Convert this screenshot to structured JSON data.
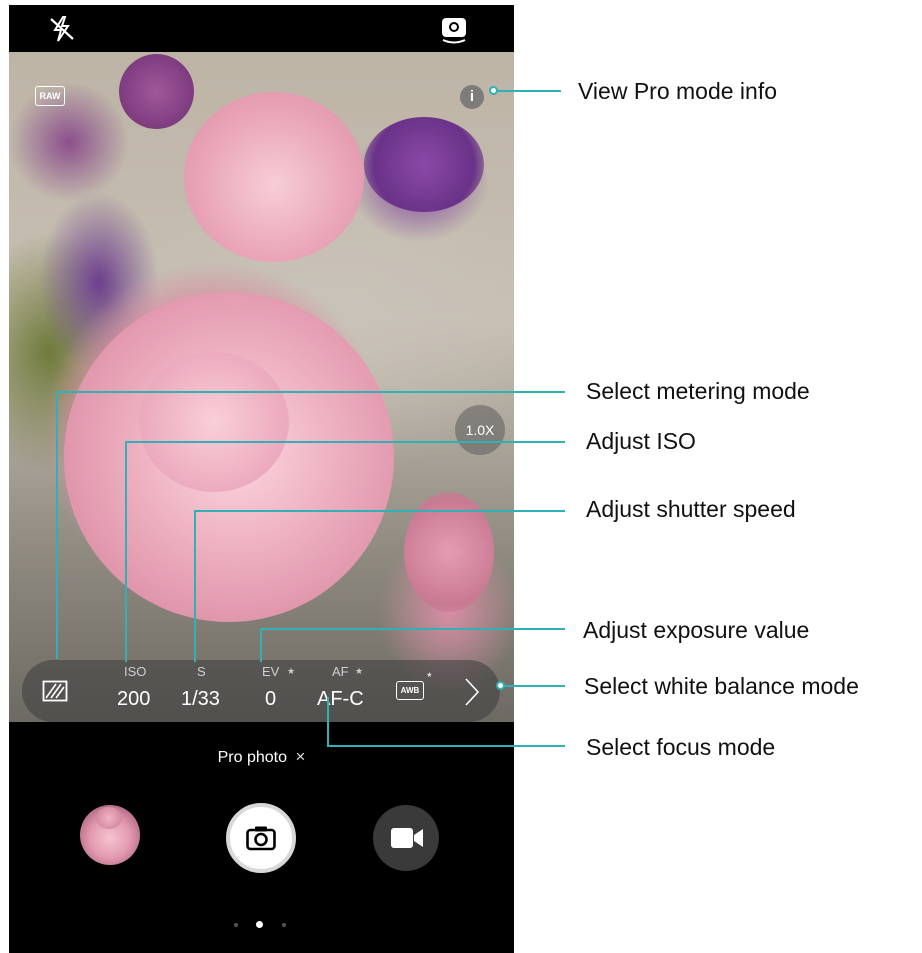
{
  "zoom_label": "1.0X",
  "raw_badge": "RAW",
  "info_icon_glyph": "i",
  "pro_params": [
    {
      "key": "metering",
      "label": "",
      "value": ""
    },
    {
      "key": "iso",
      "label": "ISO",
      "value": "200"
    },
    {
      "key": "shutter",
      "label": "S",
      "value": "1/33"
    },
    {
      "key": "ev",
      "label": "EV",
      "value": "0",
      "star": "★"
    },
    {
      "key": "af",
      "label": "AF",
      "value": "AF-C",
      "star": "★"
    }
  ],
  "awb_label": "AWB",
  "awb_star": "*",
  "mode_label": "Pro photo",
  "mode_close": "×",
  "annotations": {
    "info": "View Pro mode info",
    "metering": "Select metering mode",
    "iso": "Adjust ISO",
    "shutter": "Adjust shutter speed",
    "ev": "Adjust exposure value",
    "wb": "Select white balance mode",
    "focus": "Select focus mode"
  },
  "colors": {
    "accent_line": "#2fb1b5",
    "hud_bg": "#3c3c3c"
  },
  "icons": [
    "flash-off-icon",
    "switch-camera-icon",
    "raw-icon",
    "info-icon",
    "metering-icon",
    "awb-icon",
    "chevron-right-icon",
    "gallery-thumbnail",
    "shutter-camera-icon",
    "video-record-icon"
  ],
  "page_indicator": {
    "count": 3,
    "active": 1
  }
}
